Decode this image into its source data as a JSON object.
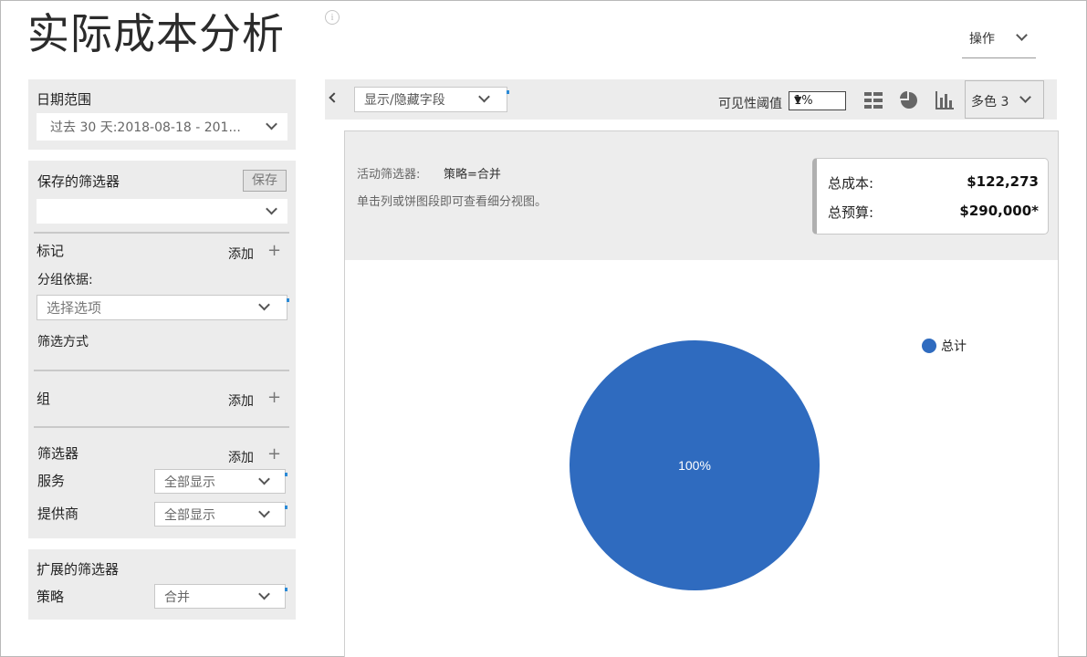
{
  "page": {
    "title": "实际成本分析",
    "info_glyph": "i"
  },
  "actions": {
    "label": "操作"
  },
  "date_range": {
    "label": "日期范围",
    "value": "过去 30 天:2018-08-18 - 201..."
  },
  "saved_filters": {
    "label": "保存的筛选器",
    "save_button": "保存",
    "value": ""
  },
  "tags": {
    "label": "标记",
    "add_label": "添加",
    "group_by_label": "分组依据:",
    "group_by_placeholder": "选择选项",
    "filter_by_label": "筛选方式"
  },
  "groups": {
    "label": "组",
    "add_label": "添加"
  },
  "filters": {
    "label": "筛选器",
    "add_label": "添加",
    "rows": [
      {
        "label": "服务",
        "value": "全部显示"
      },
      {
        "label": "提供商",
        "value": "全部显示"
      }
    ]
  },
  "extended_filters": {
    "label": "扩展的筛选器",
    "rows": [
      {
        "label": "策略",
        "value": "合并"
      }
    ]
  },
  "toolbar": {
    "fields_dropdown": "显示/隐藏字段",
    "threshold_label": "可见性阈值",
    "threshold_value": "1%",
    "threshold_arrow": "▼",
    "color_scheme": "多色 3",
    "icons": [
      "grid-icon",
      "pie-chart-icon",
      "bar-chart-icon"
    ]
  },
  "summary_header": {
    "active_filters_label": "活动筛选器:",
    "active_filters_value": "策略=合并",
    "hint": "单击列或饼图段即可查看细分视图。",
    "total_cost_label": "总成本:",
    "total_cost_value": "$122,273",
    "total_budget_label": "总预算:",
    "total_budget_value": "$290,000*"
  },
  "colors": {
    "accent": "#2f6bbf",
    "panel": "#ececec"
  },
  "chart_data": {
    "type": "pie",
    "slices": [
      {
        "name": "总计",
        "value": 100,
        "label": "100%",
        "color": "#2f6bbf"
      }
    ],
    "legend": [
      {
        "name": "总计",
        "color": "#2f6bbf"
      }
    ],
    "legend_position": "top-right"
  }
}
